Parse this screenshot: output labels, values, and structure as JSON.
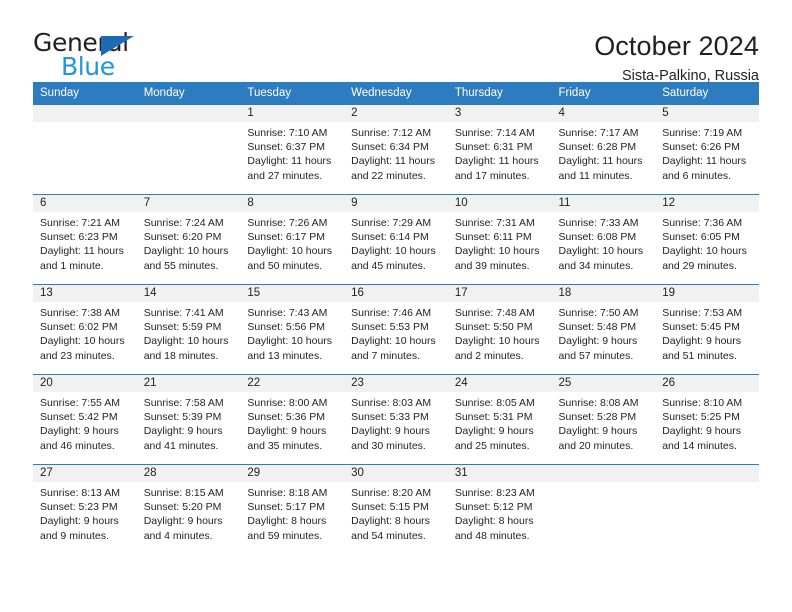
{
  "logo": {
    "text_primary": "General",
    "text_secondary": "Blue",
    "primary_color": "#231f20",
    "secondary_color": "#2196d8",
    "triangle_color": "#1b6cb5"
  },
  "header": {
    "title": "October 2024",
    "subtitle": "Sista-Palkino, Russia"
  },
  "theme": {
    "header_bg": "#2e7cc0",
    "header_text": "#ffffff",
    "daynum_band_bg": "#f1f1f1",
    "cell_text": "#231f20"
  },
  "calendar": {
    "weekday_headers": [
      "Sunday",
      "Monday",
      "Tuesday",
      "Wednesday",
      "Thursday",
      "Friday",
      "Saturday"
    ],
    "weeks": [
      [
        {
          "day": "",
          "sunrise": "",
          "sunset": "",
          "daylight_1": "",
          "daylight_2": ""
        },
        {
          "day": "",
          "sunrise": "",
          "sunset": "",
          "daylight_1": "",
          "daylight_2": ""
        },
        {
          "day": "1",
          "sunrise": "Sunrise: 7:10 AM",
          "sunset": "Sunset: 6:37 PM",
          "daylight_1": "Daylight: 11 hours",
          "daylight_2": "and 27 minutes."
        },
        {
          "day": "2",
          "sunrise": "Sunrise: 7:12 AM",
          "sunset": "Sunset: 6:34 PM",
          "daylight_1": "Daylight: 11 hours",
          "daylight_2": "and 22 minutes."
        },
        {
          "day": "3",
          "sunrise": "Sunrise: 7:14 AM",
          "sunset": "Sunset: 6:31 PM",
          "daylight_1": "Daylight: 11 hours",
          "daylight_2": "and 17 minutes."
        },
        {
          "day": "4",
          "sunrise": "Sunrise: 7:17 AM",
          "sunset": "Sunset: 6:28 PM",
          "daylight_1": "Daylight: 11 hours",
          "daylight_2": "and 11 minutes."
        },
        {
          "day": "5",
          "sunrise": "Sunrise: 7:19 AM",
          "sunset": "Sunset: 6:26 PM",
          "daylight_1": "Daylight: 11 hours",
          "daylight_2": "and 6 minutes."
        }
      ],
      [
        {
          "day": "6",
          "sunrise": "Sunrise: 7:21 AM",
          "sunset": "Sunset: 6:23 PM",
          "daylight_1": "Daylight: 11 hours",
          "daylight_2": "and 1 minute."
        },
        {
          "day": "7",
          "sunrise": "Sunrise: 7:24 AM",
          "sunset": "Sunset: 6:20 PM",
          "daylight_1": "Daylight: 10 hours",
          "daylight_2": "and 55 minutes."
        },
        {
          "day": "8",
          "sunrise": "Sunrise: 7:26 AM",
          "sunset": "Sunset: 6:17 PM",
          "daylight_1": "Daylight: 10 hours",
          "daylight_2": "and 50 minutes."
        },
        {
          "day": "9",
          "sunrise": "Sunrise: 7:29 AM",
          "sunset": "Sunset: 6:14 PM",
          "daylight_1": "Daylight: 10 hours",
          "daylight_2": "and 45 minutes."
        },
        {
          "day": "10",
          "sunrise": "Sunrise: 7:31 AM",
          "sunset": "Sunset: 6:11 PM",
          "daylight_1": "Daylight: 10 hours",
          "daylight_2": "and 39 minutes."
        },
        {
          "day": "11",
          "sunrise": "Sunrise: 7:33 AM",
          "sunset": "Sunset: 6:08 PM",
          "daylight_1": "Daylight: 10 hours",
          "daylight_2": "and 34 minutes."
        },
        {
          "day": "12",
          "sunrise": "Sunrise: 7:36 AM",
          "sunset": "Sunset: 6:05 PM",
          "daylight_1": "Daylight: 10 hours",
          "daylight_2": "and 29 minutes."
        }
      ],
      [
        {
          "day": "13",
          "sunrise": "Sunrise: 7:38 AM",
          "sunset": "Sunset: 6:02 PM",
          "daylight_1": "Daylight: 10 hours",
          "daylight_2": "and 23 minutes."
        },
        {
          "day": "14",
          "sunrise": "Sunrise: 7:41 AM",
          "sunset": "Sunset: 5:59 PM",
          "daylight_1": "Daylight: 10 hours",
          "daylight_2": "and 18 minutes."
        },
        {
          "day": "15",
          "sunrise": "Sunrise: 7:43 AM",
          "sunset": "Sunset: 5:56 PM",
          "daylight_1": "Daylight: 10 hours",
          "daylight_2": "and 13 minutes."
        },
        {
          "day": "16",
          "sunrise": "Sunrise: 7:46 AM",
          "sunset": "Sunset: 5:53 PM",
          "daylight_1": "Daylight: 10 hours",
          "daylight_2": "and 7 minutes."
        },
        {
          "day": "17",
          "sunrise": "Sunrise: 7:48 AM",
          "sunset": "Sunset: 5:50 PM",
          "daylight_1": "Daylight: 10 hours",
          "daylight_2": "and 2 minutes."
        },
        {
          "day": "18",
          "sunrise": "Sunrise: 7:50 AM",
          "sunset": "Sunset: 5:48 PM",
          "daylight_1": "Daylight: 9 hours",
          "daylight_2": "and 57 minutes."
        },
        {
          "day": "19",
          "sunrise": "Sunrise: 7:53 AM",
          "sunset": "Sunset: 5:45 PM",
          "daylight_1": "Daylight: 9 hours",
          "daylight_2": "and 51 minutes."
        }
      ],
      [
        {
          "day": "20",
          "sunrise": "Sunrise: 7:55 AM",
          "sunset": "Sunset: 5:42 PM",
          "daylight_1": "Daylight: 9 hours",
          "daylight_2": "and 46 minutes."
        },
        {
          "day": "21",
          "sunrise": "Sunrise: 7:58 AM",
          "sunset": "Sunset: 5:39 PM",
          "daylight_1": "Daylight: 9 hours",
          "daylight_2": "and 41 minutes."
        },
        {
          "day": "22",
          "sunrise": "Sunrise: 8:00 AM",
          "sunset": "Sunset: 5:36 PM",
          "daylight_1": "Daylight: 9 hours",
          "daylight_2": "and 35 minutes."
        },
        {
          "day": "23",
          "sunrise": "Sunrise: 8:03 AM",
          "sunset": "Sunset: 5:33 PM",
          "daylight_1": "Daylight: 9 hours",
          "daylight_2": "and 30 minutes."
        },
        {
          "day": "24",
          "sunrise": "Sunrise: 8:05 AM",
          "sunset": "Sunset: 5:31 PM",
          "daylight_1": "Daylight: 9 hours",
          "daylight_2": "and 25 minutes."
        },
        {
          "day": "25",
          "sunrise": "Sunrise: 8:08 AM",
          "sunset": "Sunset: 5:28 PM",
          "daylight_1": "Daylight: 9 hours",
          "daylight_2": "and 20 minutes."
        },
        {
          "day": "26",
          "sunrise": "Sunrise: 8:10 AM",
          "sunset": "Sunset: 5:25 PM",
          "daylight_1": "Daylight: 9 hours",
          "daylight_2": "and 14 minutes."
        }
      ],
      [
        {
          "day": "27",
          "sunrise": "Sunrise: 8:13 AM",
          "sunset": "Sunset: 5:23 PM",
          "daylight_1": "Daylight: 9 hours",
          "daylight_2": "and 9 minutes."
        },
        {
          "day": "28",
          "sunrise": "Sunrise: 8:15 AM",
          "sunset": "Sunset: 5:20 PM",
          "daylight_1": "Daylight: 9 hours",
          "daylight_2": "and 4 minutes."
        },
        {
          "day": "29",
          "sunrise": "Sunrise: 8:18 AM",
          "sunset": "Sunset: 5:17 PM",
          "daylight_1": "Daylight: 8 hours",
          "daylight_2": "and 59 minutes."
        },
        {
          "day": "30",
          "sunrise": "Sunrise: 8:20 AM",
          "sunset": "Sunset: 5:15 PM",
          "daylight_1": "Daylight: 8 hours",
          "daylight_2": "and 54 minutes."
        },
        {
          "day": "31",
          "sunrise": "Sunrise: 8:23 AM",
          "sunset": "Sunset: 5:12 PM",
          "daylight_1": "Daylight: 8 hours",
          "daylight_2": "and 48 minutes."
        },
        {
          "day": "",
          "sunrise": "",
          "sunset": "",
          "daylight_1": "",
          "daylight_2": ""
        },
        {
          "day": "",
          "sunrise": "",
          "sunset": "",
          "daylight_1": "",
          "daylight_2": ""
        }
      ]
    ]
  }
}
